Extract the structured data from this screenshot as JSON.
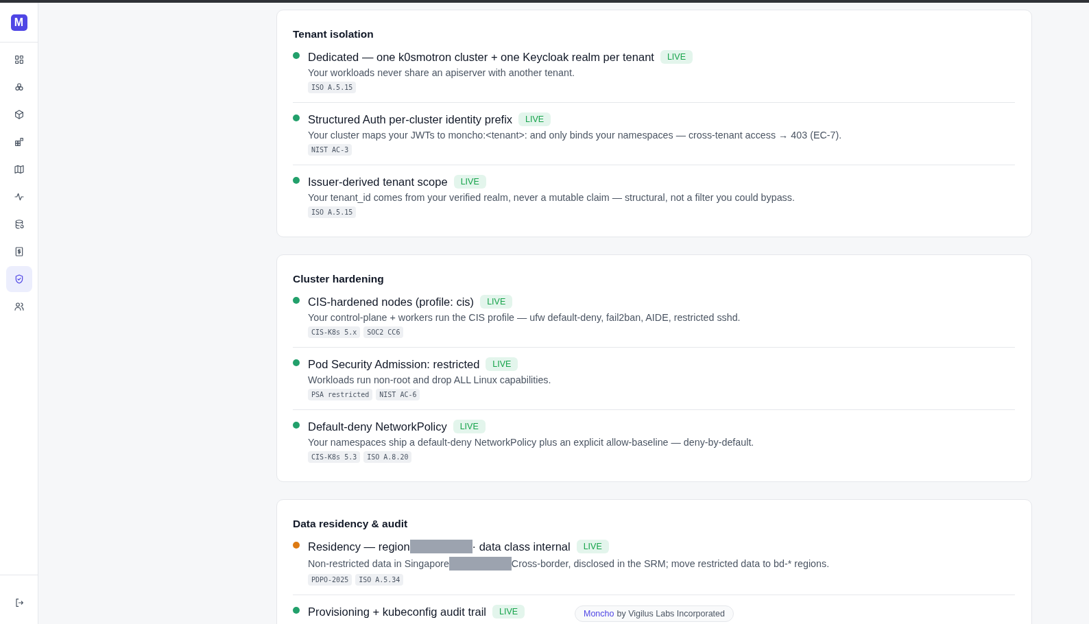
{
  "sidebar": {
    "logo": "M",
    "items": [
      {
        "selected": false
      },
      {
        "selected": false
      },
      {
        "selected": false
      },
      {
        "selected": false
      },
      {
        "selected": false
      },
      {
        "selected": false
      },
      {
        "selected": false
      },
      {
        "selected": false
      },
      {
        "selected": true
      },
      {
        "selected": false
      }
    ]
  },
  "sections": [
    {
      "title": "Tenant isolation",
      "controls": [
        {
          "title": [
            {
              "kind": "text",
              "text": "Dedicated — one k0smotron cluster + one Keycloak realm per tenant"
            }
          ],
          "status": "LIVE",
          "color": "#22a06b",
          "description": [
            {
              "kind": "text",
              "text": "Your workloads never share an apiserver with another tenant."
            }
          ],
          "tags": [
            "ISO A.5.15"
          ]
        },
        {
          "title": [
            {
              "kind": "text",
              "text": "Structured Auth per-cluster identity prefix"
            }
          ],
          "status": "LIVE",
          "color": "#22a06b",
          "description": [
            {
              "kind": "text",
              "text": "Your cluster maps your JWTs to moncho:<tenant>: and only binds your namespaces — cross-tenant access → 403 (EC-7)."
            }
          ],
          "tags": [
            "NIST AC-3"
          ]
        },
        {
          "title": [
            {
              "kind": "text",
              "text": "Issuer-derived tenant scope"
            }
          ],
          "status": "LIVE",
          "color": "#22a06b",
          "description": [
            {
              "kind": "text",
              "text": "Your tenant_id comes from your verified realm, never a mutable claim — structural, not a filter you could bypass."
            }
          ],
          "tags": [
            "ISO A.5.15"
          ]
        }
      ]
    },
    {
      "title": "Cluster hardening",
      "controls": [
        {
          "title": [
            {
              "kind": "text",
              "text": "CIS-hardened nodes (profile: cis)"
            }
          ],
          "status": "LIVE",
          "color": "#22a06b",
          "description": [
            {
              "kind": "text",
              "text": "Your control-plane + workers run the CIS profile — ufw default-deny, fail2ban, AIDE, restricted sshd."
            }
          ],
          "tags": [
            "CIS-K8s 5.x",
            "SOC2 CC6"
          ]
        },
        {
          "title": [
            {
              "kind": "text",
              "text": "Pod Security Admission: restricted"
            }
          ],
          "status": "LIVE",
          "color": "#22a06b",
          "description": [
            {
              "kind": "text",
              "text": "Workloads run non-root and drop ALL Linux capabilities."
            }
          ],
          "tags": [
            "PSA restricted",
            "NIST AC-6"
          ]
        },
        {
          "title": [
            {
              "kind": "text",
              "text": "Default-deny NetworkPolicy"
            }
          ],
          "status": "LIVE",
          "color": "#22a06b",
          "description": [
            {
              "kind": "text",
              "text": "Your namespaces ship a default-deny NetworkPolicy plus an explicit allow-baseline — deny-by-default."
            }
          ],
          "tags": [
            "CIS-K8s 5.3",
            "ISO A.8.20"
          ]
        }
      ]
    },
    {
      "title": "Data residency & audit",
      "controls": [
        {
          "title": [
            {
              "kind": "text",
              "text": "Residency — region"
            },
            {
              "kind": "redaction"
            },
            {
              "kind": "text",
              "text": "· data class internal"
            }
          ],
          "status": "LIVE",
          "color": "#dd7a12",
          "description": [
            {
              "kind": "text",
              "text": "Non-restricted data in Singapore"
            },
            {
              "kind": "redaction"
            },
            {
              "kind": "text",
              "text": "Cross-border, disclosed in the SRM; move restricted data to bd-* regions."
            }
          ],
          "tags": [
            "PDPO-2025",
            "ISO A.5.34"
          ]
        },
        {
          "title": [
            {
              "kind": "text",
              "text": "Provisioning + kubeconfig audit trail"
            }
          ],
          "status": "LIVE",
          "color": "#22a06b"
        }
      ]
    }
  ],
  "footer": {
    "brand": "Moncho",
    "text": "by Vigilus Labs Incorporated"
  }
}
